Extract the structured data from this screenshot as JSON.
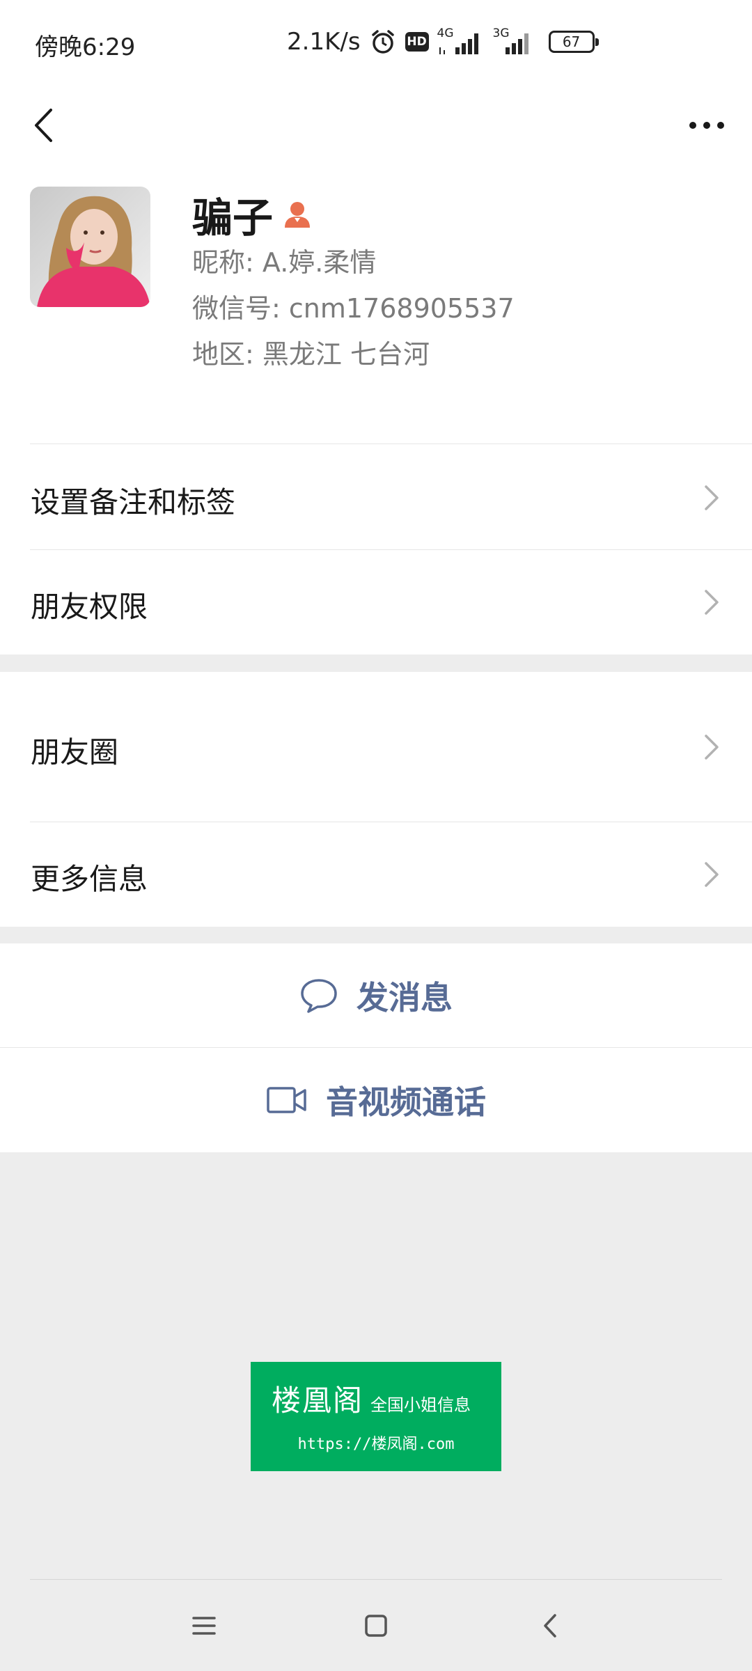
{
  "status_bar": {
    "time": "傍晚6:29",
    "net_speed": "2.1K/s",
    "hd_badge": "HD",
    "signal1_type": "4G",
    "signal2_type": "3G",
    "battery": "67"
  },
  "profile": {
    "name": "骗子",
    "nickname": "昵称:  A.婷.柔情",
    "wechat_id": "微信号:  cnm1768905537",
    "region": "地区:  黑龙江  七台河",
    "gender_icon": "female-icon",
    "gender_color": "#e9704f"
  },
  "menu": {
    "remark_tags": "设置备注和标签",
    "friend_permissions": "朋友权限",
    "moments": "朋友圈",
    "more_info": "更多信息"
  },
  "actions": {
    "send_message": "发消息",
    "video_call": "音视频通话"
  },
  "watermark": {
    "title": "楼凰阁",
    "subtitle": "全国小姐信息",
    "url": "https://楼凤阁.com"
  },
  "colors": {
    "action_text": "#576b95",
    "watermark_bg": "#00ad5f"
  }
}
